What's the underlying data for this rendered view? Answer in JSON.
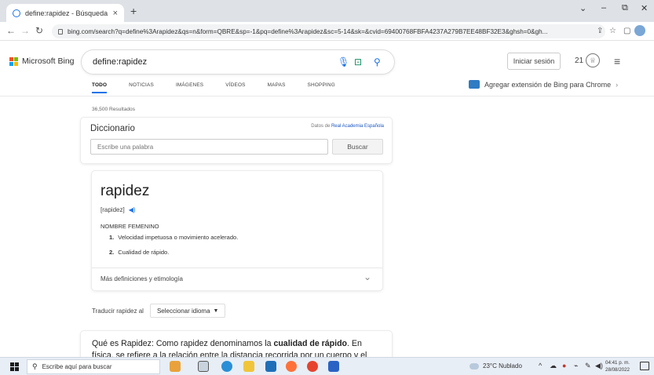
{
  "browser": {
    "tab_title": "define:rapidez - Búsqueda",
    "tab_close": "×",
    "new_tab": "+",
    "url": "bing.com/search?q=define%3Arapidez&qs=n&form=QBRE&sp=-1&pq=define%3Arapidez&sc=5-14&sk=&cvid=69400768FBFA4237A279B7EE48BF32E3&ghsh=0&gh...",
    "win_minimize": "–",
    "win_restore": "⧉",
    "win_close": "✕",
    "win_collapse": "⌄"
  },
  "bing": {
    "logo_text": "Microsoft Bing",
    "search_query": "define:rapidez",
    "signin_label": "Iniciar sesión",
    "rewards_count": "21",
    "scopes": [
      "TODO",
      "NOTICIAS",
      "IMÁGENES",
      "VÍDEOS",
      "MAPAS",
      "SHOPPING"
    ],
    "extension_text": "Agregar extensión de Bing para Chrome",
    "result_count": "36,500 Resultados"
  },
  "dictionary": {
    "title": "Diccionario",
    "source_prefix": "Datos de",
    "source_link": "Real Academia Española",
    "input_placeholder": "Escribe una palabra",
    "search_button": "Buscar",
    "word": "rapidez",
    "pronunciation": "[rapidez]",
    "part_of_speech": "NOMBRE FEMENINO",
    "definitions": [
      {
        "num": "1.",
        "text": "Velocidad impetuosa o movimiento acelerado."
      },
      {
        "num": "2.",
        "text": "Cualidad de rápido."
      }
    ],
    "more_label": "Más definiciones y etimología",
    "translate_label": "Traducir rapidez al",
    "language_select": "Seleccionar idioma"
  },
  "snippet": {
    "line_prefix": "Qué es Rapidez: Como rapidez denominamos la",
    "bold": "cualidad de rápido",
    "line_suffix": ". En física, se refiere a la relación entre la distancia recorrida por un cuerpo y el"
  },
  "taskbar": {
    "search_placeholder": "Escribe aquí para buscar",
    "weather": "23°C Nublado",
    "time": "04:41 p. m.",
    "date": "28/08/2022"
  },
  "colors": {
    "accent": "#1a73e8",
    "ms_red": "#f25022",
    "ms_green": "#7fba00",
    "ms_blue": "#00a4ef",
    "ms_yellow": "#ffb900"
  }
}
